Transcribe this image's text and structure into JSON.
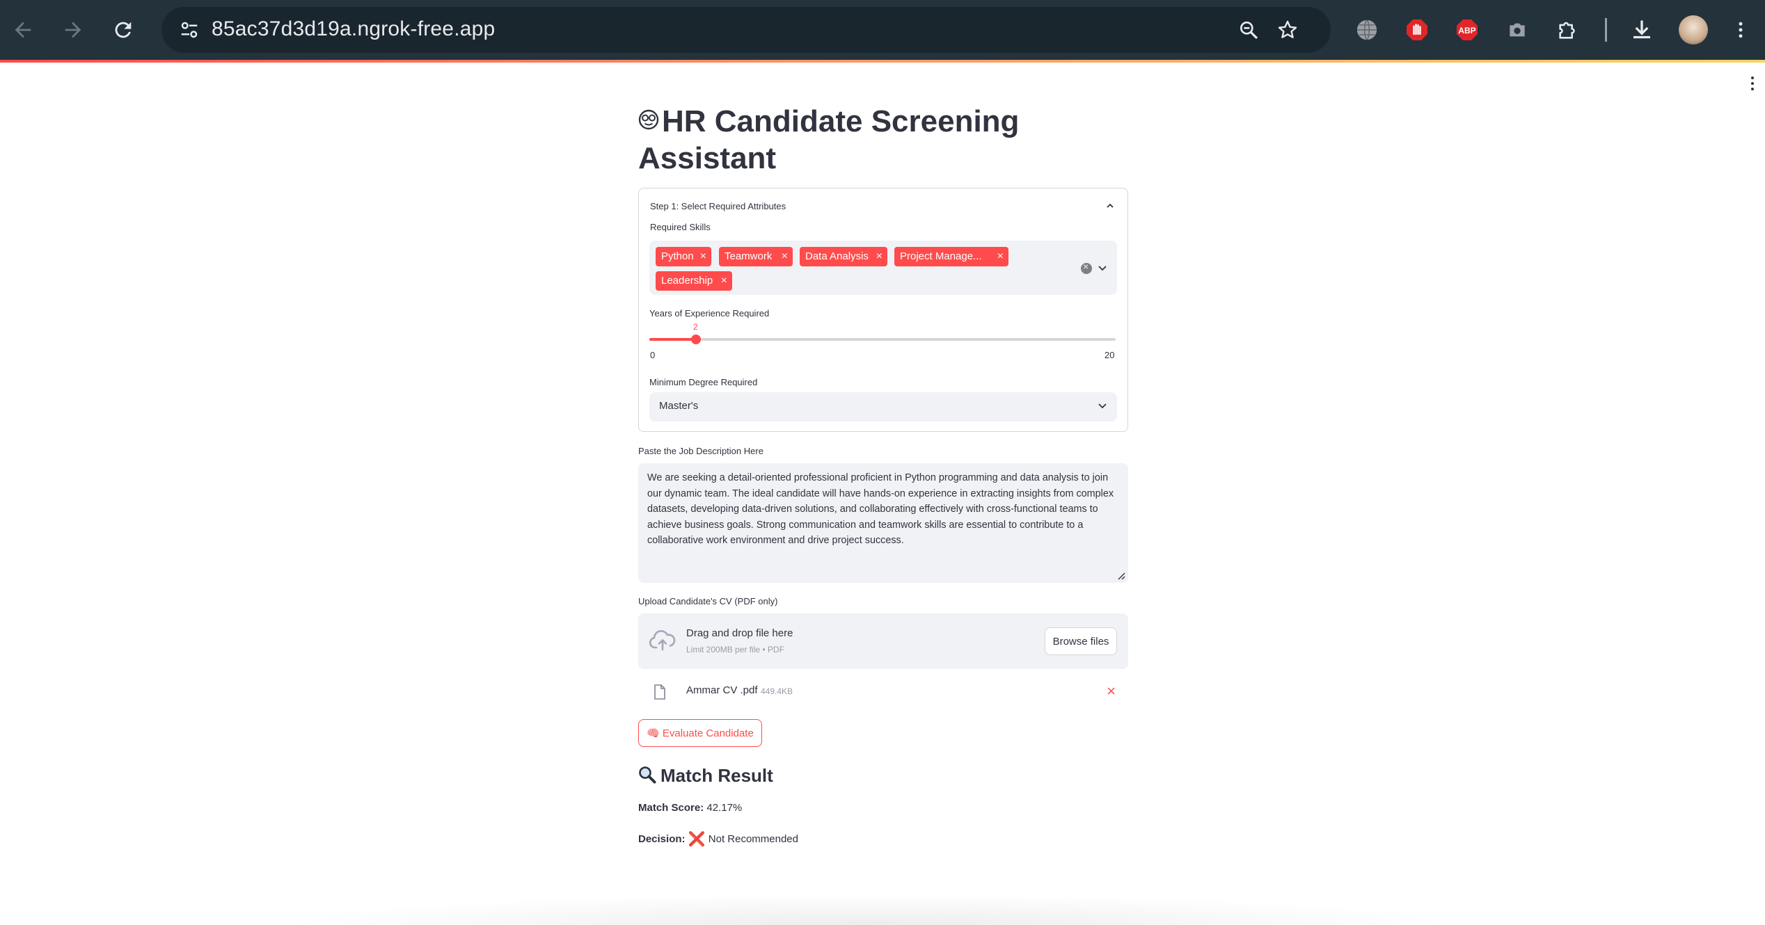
{
  "browser": {
    "url": "85ac37d3d19a.ngrok-free.app",
    "icons": [
      "back-icon",
      "forward-icon",
      "reload-icon",
      "site-settings-icon",
      "zoom-icon",
      "bookmark-star-icon",
      "globe-extension-icon",
      "stop-hand-extension-icon",
      "adblock-extension-icon",
      "camera-extension-icon",
      "puzzle-extensions-icon",
      "download-icon",
      "profile-avatar",
      "kebab-menu-icon"
    ],
    "abp_label": "ABP"
  },
  "app": {
    "title": "HR Candidate Screening Assistant",
    "title_icon": "nerd-face-emoji"
  },
  "step1": {
    "header": "Step 1: Select Required Attributes",
    "skills_label": "Required Skills",
    "skills": [
      "Python",
      "Teamwork",
      "Data Analysis",
      "Project Manage...",
      "Leadership"
    ],
    "experience_label": "Years of Experience Required",
    "experience": {
      "value": "2",
      "min": "0",
      "max": "20"
    },
    "degree_label": "Minimum Degree Required",
    "degree_value": "Master's"
  },
  "job_description": {
    "label": "Paste the Job Description Here",
    "text": "We are seeking a detail-oriented professional proficient in Python programming and data analysis to join our dynamic team. The ideal candidate will have hands-on experience in extracting insights from complex datasets, developing data-driven solutions, and collaborating effectively with cross-functional teams to achieve business goals. Strong communication and teamwork skills are essential to contribute to a collaborative work environment and drive project success."
  },
  "upload": {
    "label": "Upload Candidate's CV (PDF only)",
    "drop_text": "Drag and drop file here",
    "limit_text": "Limit 200MB per file • PDF",
    "browse_label": "Browse files",
    "file_name": "Ammar CV .pdf",
    "file_size": "449.4KB"
  },
  "evaluate": {
    "button_icon": "🧠",
    "button_label": "Evaluate Candidate"
  },
  "result": {
    "heading": "Match Result",
    "score_label": "Match Score:",
    "score_value": "42.17%",
    "decision_label": "Decision:",
    "decision_icon": "❌",
    "decision_value": "Not Recommended"
  }
}
